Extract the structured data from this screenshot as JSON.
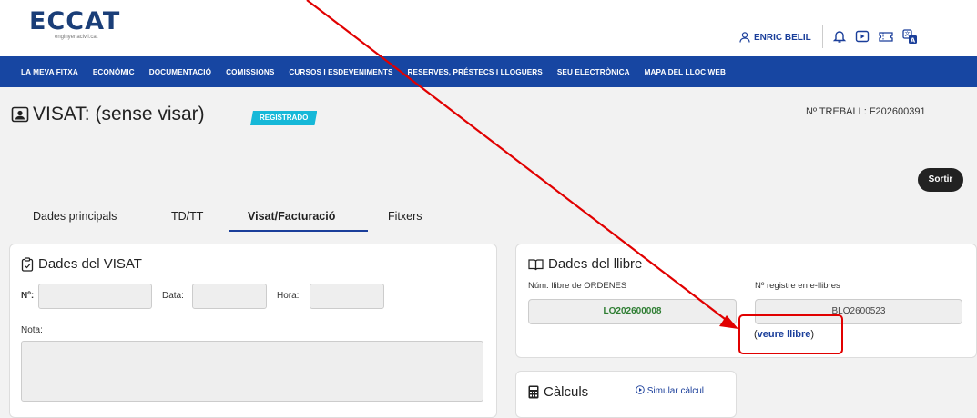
{
  "header": {
    "logo": "ECCAT",
    "logo_sub": "enginyeriacivil.cat",
    "user_name": "ENRIC BELIL",
    "icons": [
      "person-icon",
      "bell-icon",
      "play-icon",
      "ticket-icon",
      "translate-icon"
    ]
  },
  "nav": {
    "items": [
      "LA MEVA FITXA",
      "ECONÒMIC",
      "DOCUMENTACIÓ",
      "COMISSIONS",
      "CURSOS I ESDEVENIMENTS",
      "RESERVES, PRÉSTECS I LLOGUERS",
      "SEU ELECTRÒNICA",
      "MAPA DEL LLOC WEB"
    ]
  },
  "page": {
    "title": "VISAT: (sense visar)",
    "badge": "REGISTRADO",
    "treball": "Nº TREBALL: F202600391",
    "sortir": "Sortir"
  },
  "tabs": [
    "Dades principals",
    "TD/TT",
    "Visat/Facturació",
    "Fitxers"
  ],
  "active_tab": "Visat/Facturació",
  "visat": {
    "title": "Dades del VISAT",
    "num_label": "Nº:",
    "data_label": "Data:",
    "hora_label": "Hora:",
    "nota_label": "Nota:"
  },
  "llibre": {
    "title": "Dades del llibre",
    "ordenes_label": "Núm. llibre de ORDENES",
    "ordenes_value": "LO202600008",
    "registre_label": "Nº registre en e-llibres",
    "registre_value": "BLO2600523",
    "veure_open": "(",
    "veure_link": "veure llibre",
    "veure_close": ")"
  },
  "calculs": {
    "title": "Càlculs",
    "simular": "Simular càlcul"
  },
  "colors": {
    "nav_bg": "#1746a2",
    "badge": "#16b8d8",
    "ordenes_value": "#2e7d32",
    "highlight": "#e10000"
  }
}
